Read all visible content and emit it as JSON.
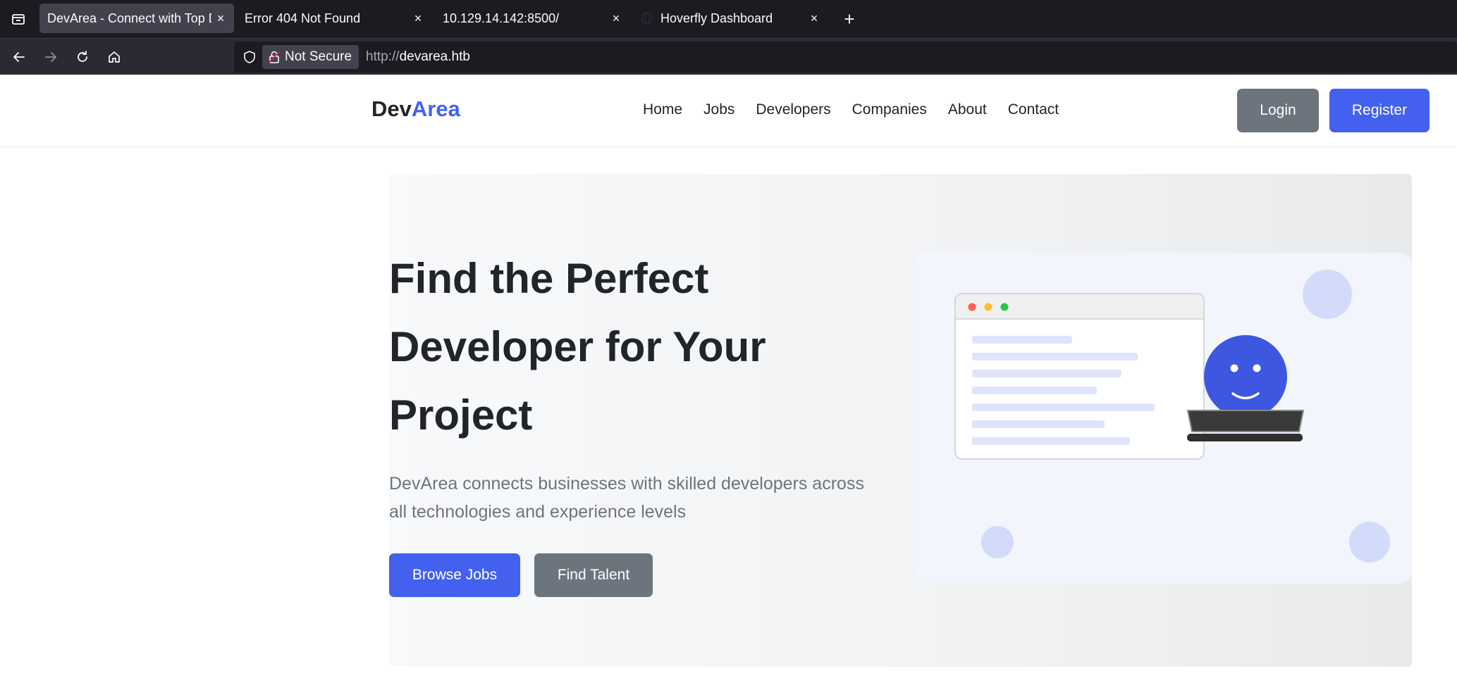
{
  "browser": {
    "tabs": [
      {
        "title": "DevArea - Connect with Top Developers",
        "active": true
      },
      {
        "title": "Error 404 Not Found",
        "active": false
      },
      {
        "title": "10.129.14.142:8500/",
        "active": false
      },
      {
        "title": "Hoverfly Dashboard",
        "active": false
      }
    ],
    "close_glyph": "×",
    "new_tab_glyph": "+",
    "security_label": "Not Secure",
    "url_scheme": "http://",
    "url_host": "devarea.htb"
  },
  "site": {
    "logo_main": "Dev",
    "logo_accent": "Area",
    "nav": [
      "Home",
      "Jobs",
      "Developers",
      "Companies",
      "About",
      "Contact"
    ],
    "login_label": "Login",
    "register_label": "Register"
  },
  "hero": {
    "title": "Find the Perfect Developer for Your Project",
    "subtitle": "DevArea connects businesses with skilled developers across all technologies and experience levels",
    "browse_label": "Browse Jobs",
    "find_label": "Find Talent"
  },
  "colors": {
    "accent": "#4361ee",
    "secondary": "#6c757d",
    "text": "#212529"
  }
}
